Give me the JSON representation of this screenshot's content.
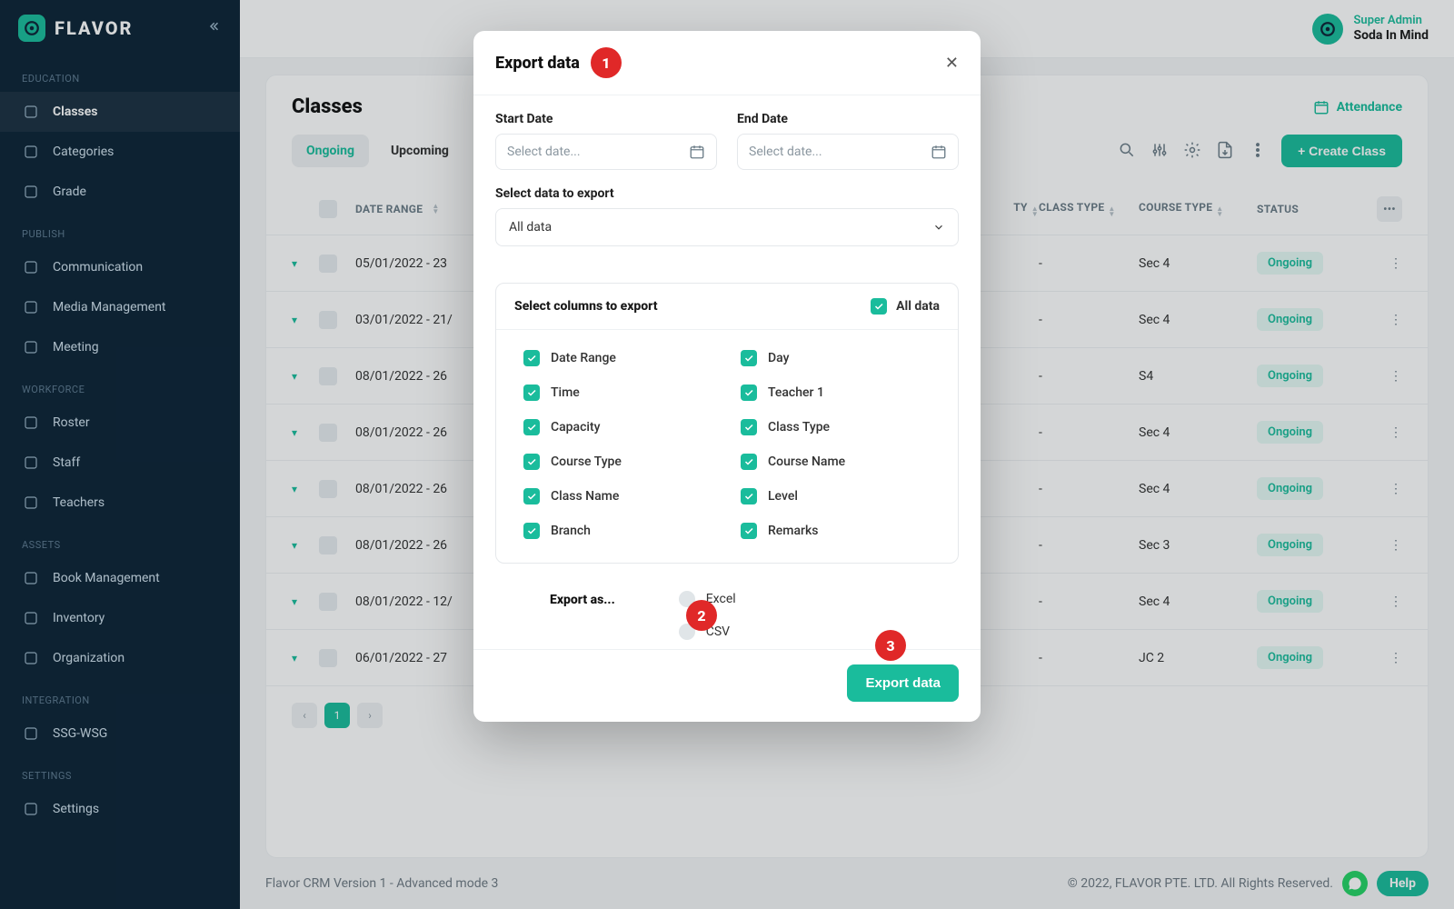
{
  "brand": {
    "name": "FLAVOR"
  },
  "user": {
    "role": "Super Admin",
    "org": "Soda In Mind"
  },
  "sidebar": {
    "sections": [
      {
        "title": "EDUCATION",
        "items": [
          {
            "label": "Classes",
            "icon": "book-open",
            "active": true
          },
          {
            "label": "Categories",
            "icon": "tag"
          },
          {
            "label": "Grade",
            "icon": "grade"
          }
        ]
      },
      {
        "title": "PUBLISH",
        "items": [
          {
            "label": "Communication",
            "icon": "chat"
          },
          {
            "label": "Media Management",
            "icon": "image"
          },
          {
            "label": "Meeting",
            "icon": "video"
          }
        ]
      },
      {
        "title": "WORKFORCE",
        "items": [
          {
            "label": "Roster",
            "icon": "calendar"
          },
          {
            "label": "Staff",
            "icon": "users"
          },
          {
            "label": "Teachers",
            "icon": "academic"
          }
        ]
      },
      {
        "title": "ASSETS",
        "items": [
          {
            "label": "Book Management",
            "icon": "book"
          },
          {
            "label": "Inventory",
            "icon": "box"
          },
          {
            "label": "Organization",
            "icon": "building"
          }
        ]
      },
      {
        "title": "INTEGRATION",
        "items": [
          {
            "label": "SSG-WSG",
            "icon": "layers"
          }
        ]
      },
      {
        "title": "SETTINGS",
        "items": [
          {
            "label": "Settings",
            "icon": "gear"
          }
        ]
      }
    ]
  },
  "page": {
    "title": "Classes",
    "attendanceLabel": "Attendance",
    "tabs": [
      "Ongoing",
      "Upcoming"
    ],
    "activeTab": 0,
    "createButton": "+ Create Class"
  },
  "table": {
    "headers": {
      "dateRange": "DATE RANGE",
      "capacity": "TY",
      "classType": "CLASS TYPE",
      "courseType": "COURSE TYPE",
      "status": "STATUS"
    },
    "rows": [
      {
        "dateRange": "05/01/2022 - 23",
        "classType": "-",
        "courseType": "Sec 4",
        "status": "Ongoing"
      },
      {
        "dateRange": "03/01/2022 - 21/",
        "classType": "-",
        "courseType": "Sec 4",
        "status": "Ongoing"
      },
      {
        "dateRange": "08/01/2022 - 26",
        "classType": "-",
        "courseType": "S4",
        "status": "Ongoing"
      },
      {
        "dateRange": "08/01/2022 - 26",
        "classType": "-",
        "courseType": "Sec 4",
        "status": "Ongoing"
      },
      {
        "dateRange": "08/01/2022 - 26",
        "classType": "-",
        "courseType": "Sec 4",
        "status": "Ongoing"
      },
      {
        "dateRange": "08/01/2022 - 26",
        "classType": "-",
        "courseType": "Sec 3",
        "status": "Ongoing"
      },
      {
        "dateRange": "08/01/2022 - 12/",
        "classType": "-",
        "courseType": "Sec 4",
        "status": "Ongoing"
      },
      {
        "dateRange": "06/01/2022 - 27",
        "classType": "-",
        "courseType": "JC 2",
        "status": "Ongoing"
      }
    ],
    "pagination": {
      "current": "1"
    }
  },
  "footer": {
    "left": "Flavor CRM Version 1 - Advanced mode 3",
    "right": "© 2022, FLAVOR PTE. LTD. All Rights Reserved.",
    "help": "Help"
  },
  "modal": {
    "title": "Export data",
    "stepBadges": [
      "1",
      "2",
      "3"
    ],
    "close": "×",
    "startDateLabel": "Start Date",
    "endDateLabel": "End Date",
    "datePlaceholder": "Select date...",
    "selectDataLabel": "Select data to export",
    "selectDataValue": "All data",
    "columnsTitle": "Select columns to export",
    "allDataLabel": "All data",
    "columns": [
      "Date Range",
      "Day",
      "Time",
      "Teacher 1",
      "Capacity",
      "Class Type",
      "Course Type",
      "Course Name",
      "Class Name",
      "Level",
      "Branch",
      "Remarks"
    ],
    "exportAsLabel": "Export as...",
    "formats": [
      "Excel",
      "CSV"
    ],
    "exportButton": "Export data"
  }
}
